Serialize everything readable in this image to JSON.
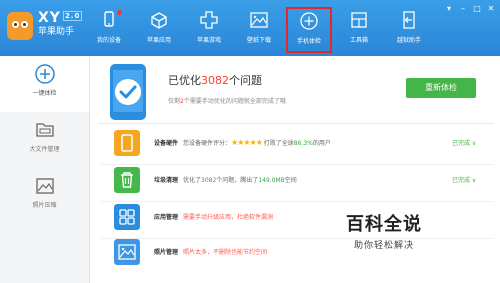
{
  "app": {
    "brand_name": "XY",
    "brand_version": "2.0",
    "brand_subtitle": "苹果助手"
  },
  "nav": {
    "items": [
      {
        "label": "我的设备",
        "icon": "device-icon",
        "badge": true
      },
      {
        "label": "苹果应用",
        "icon": "apps-icon"
      },
      {
        "label": "苹果游戏",
        "icon": "games-icon"
      },
      {
        "label": "壁纸下载",
        "icon": "wallpaper-icon"
      },
      {
        "label": "手机体检",
        "icon": "checkup-icon",
        "active": true
      },
      {
        "label": "工具箱",
        "icon": "toolbox-icon"
      },
      {
        "label": "越狱助手",
        "icon": "jailbreak-icon"
      }
    ]
  },
  "sidebar": {
    "items": [
      {
        "label": "一键体检",
        "icon": "plus-circle-icon",
        "selected": true
      },
      {
        "label": "大文件管理",
        "icon": "folder-icon"
      },
      {
        "label": "照片压缩",
        "icon": "photo-icon"
      }
    ]
  },
  "summary": {
    "title_prefix": "已优化",
    "title_count": "3082",
    "title_suffix": "个问题",
    "subtitle_prefix": "仅剩",
    "subtitle_count": "2",
    "subtitle_suffix": "个需要手动优化的问题就全部完成了哦",
    "recheck_label": "重新体检"
  },
  "rows": [
    {
      "name": "设备硬件",
      "icon": "hardware-icon",
      "desc_prefix": "您设备硬件评分：",
      "stars": "★★★★★",
      "desc_mid": " 打败了全球",
      "desc_hl": "86.3%",
      "desc_suffix": "的用户",
      "status": "已完成 ∨"
    },
    {
      "name": "垃圾清理",
      "icon": "trash-icon",
      "desc_prefix": "优化了",
      "desc_hl": "3082",
      "desc_mid": "个问题，腾出了",
      "desc_hl2": "149.0MB",
      "desc_suffix": "空间",
      "status": "已完成 ∨"
    },
    {
      "name": "应用管理",
      "icon": "apps-grid-icon",
      "warn": "需要手动升级应用，杜绝软件漏洞"
    },
    {
      "name": "照片管理",
      "icon": "image-icon",
      "warn": "照片太多，不删除也能节约空间"
    }
  ],
  "watermark": {
    "line1": "百科全说",
    "line2": "助你轻松解决"
  },
  "colors": {
    "header": "#2b86d6",
    "accent_green": "#44b549",
    "alert_red": "#ff3b30",
    "hardware_orange": "#f5a623",
    "trash_green": "#46b74a",
    "apps_blue": "#2a8ee0",
    "photo_blue": "#3d97e6"
  }
}
